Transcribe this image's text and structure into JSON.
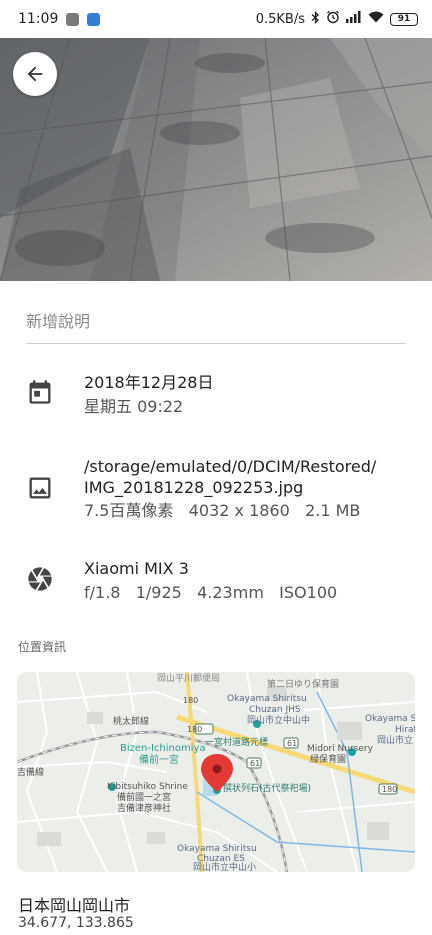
{
  "status_bar": {
    "time": "11:09",
    "network_speed": "0.5KB/s",
    "battery": "91",
    "icons": [
      "line-icon",
      "app-icon",
      "bluetooth-icon",
      "alarm-icon",
      "signal-icon",
      "wifi-icon",
      "battery-icon"
    ]
  },
  "header": {
    "back_icon": "arrow-left-icon"
  },
  "description": {
    "placeholder": "新增說明"
  },
  "date_info": {
    "date": "2018年12月28日",
    "day_time": "星期五 09:22",
    "icon": "calendar-icon"
  },
  "file_info": {
    "path_line1": "/storage/emulated/0/DCIM/Restored/",
    "path_line2": "IMG_20181228_092253.jpg",
    "megapixels": "7.5百萬像素",
    "resolution": "4032 x 1860",
    "size": "2.1 MB",
    "icon": "image-icon"
  },
  "camera_info": {
    "model": "Xiaomi MIX 3",
    "aperture": "f/1.8",
    "shutter": "1/925",
    "focal": "4.23mm",
    "iso": "ISO100",
    "icon": "aperture-icon"
  },
  "location": {
    "section_label": "位置資訊",
    "address": "日本岡山岡山市",
    "coordinates": "34.677, 133.865",
    "map": {
      "labels": {
        "post_office": "岡山平川郵便局",
        "school1_en": "Okayama Shiritsu",
        "school1_en2": "Chuzan JHS",
        "school1_ja": "岡山市立中山中",
        "school2_en": "Okayama Sh",
        "school2_en2": "Hirat",
        "school2_ja": "岡山市立",
        "line_name": "桃太郎線",
        "station_en": "Bizen-Ichinomiya",
        "station_ja": "備前一宮",
        "road_sign": "一宮村道路元標",
        "nursery_en": "Midori Nursery",
        "nursery_ja": "緑保育園",
        "shrine_en": "Kibitsuhiko Shrine",
        "shrine_ja1": "備前國一之宮",
        "shrine_ja2": "吉備津彦神社",
        "poi": "撰状列石(古代祭祀場)",
        "line2": "吉備線",
        "school3_en": "Okayama Shiritsu",
        "school3_en2": "Chuzan ES",
        "school3_ja": "岡山市立中山小",
        "top_right": "第二日ゆり保育園",
        "route1": "180",
        "route2": "61",
        "route3": "61",
        "route4": "180"
      }
    }
  }
}
